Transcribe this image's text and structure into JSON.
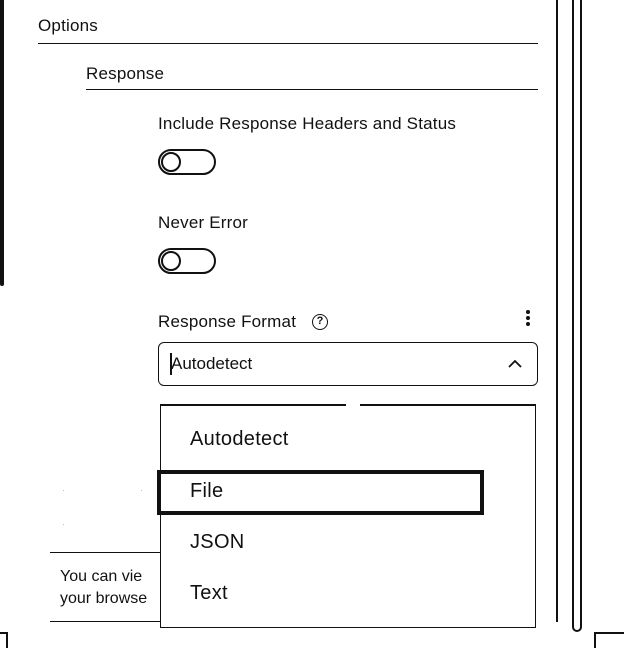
{
  "options": {
    "title": "Options",
    "response": {
      "title": "Response",
      "include_headers": {
        "label": "Include Response Headers and Status",
        "enabled": false
      },
      "never_error": {
        "label": "Never Error",
        "enabled": false
      },
      "response_format": {
        "label": "Response Format",
        "help_icon": "question-circle",
        "menu_icon": "vertical-ellipsis",
        "value": "Autodetect",
        "expand_icon": "chevron-up",
        "options": [
          "Autodetect",
          "File",
          "JSON",
          "Text"
        ],
        "highlighted": "File"
      }
    }
  },
  "background": {
    "note_line1": "You can vie",
    "note_line2": "your browse"
  }
}
